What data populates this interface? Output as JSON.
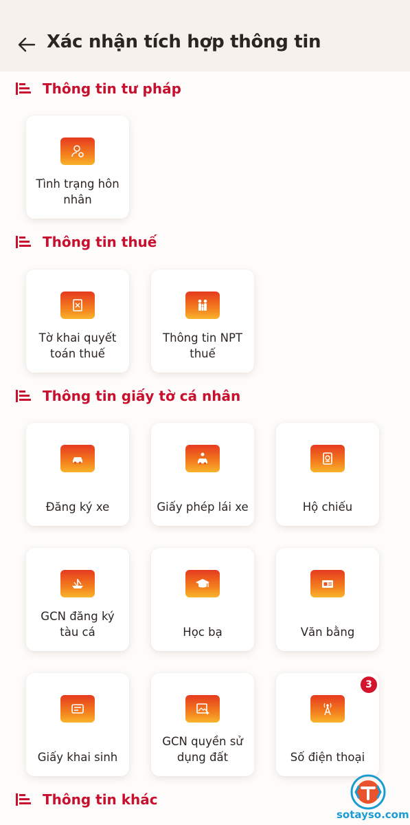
{
  "header": {
    "title": "Xác nhận tích hợp thông tin"
  },
  "sections": [
    {
      "title": "Thông tin tư pháp",
      "cards": [
        {
          "label": "Tình trạng hôn nhân",
          "icon": "marriage-person-icon"
        }
      ]
    },
    {
      "title": "Thông tin thuế",
      "cards": [
        {
          "label": "Tờ khai quyết toán thuế",
          "icon": "tax-document-icon"
        },
        {
          "label": "Thông tin NPT thuế",
          "icon": "family-icon"
        }
      ]
    },
    {
      "title": "Thông tin giấy tờ cá nhân",
      "cards": [
        {
          "label": "Đăng ký xe",
          "icon": "car-icon"
        },
        {
          "label": "Giấy phép lái xe",
          "icon": "driver-license-icon"
        },
        {
          "label": "Hộ chiếu",
          "icon": "passport-icon"
        },
        {
          "label": "GCN đăng ký tàu cá",
          "icon": "fishing-boat-icon"
        },
        {
          "label": "Học bạ",
          "icon": "graduation-cap-icon"
        },
        {
          "label": "Văn bằng",
          "icon": "diploma-icon"
        },
        {
          "label": "Giấy khai sinh",
          "icon": "birth-certificate-icon"
        },
        {
          "label": "GCN quyền sử dụng đất",
          "icon": "land-certificate-icon"
        },
        {
          "label": "Số điện thoại",
          "icon": "antenna-icon",
          "badge": "3"
        }
      ]
    },
    {
      "title": "Thông tin khác",
      "cards": []
    }
  ],
  "watermark": {
    "text": "sotayso.com"
  },
  "colors": {
    "accent": "#c8102e",
    "tile_top": "#e63a1f",
    "tile_bottom": "#f9b42b",
    "badge": "#d4142d",
    "watermark": "#1a9bd1"
  }
}
